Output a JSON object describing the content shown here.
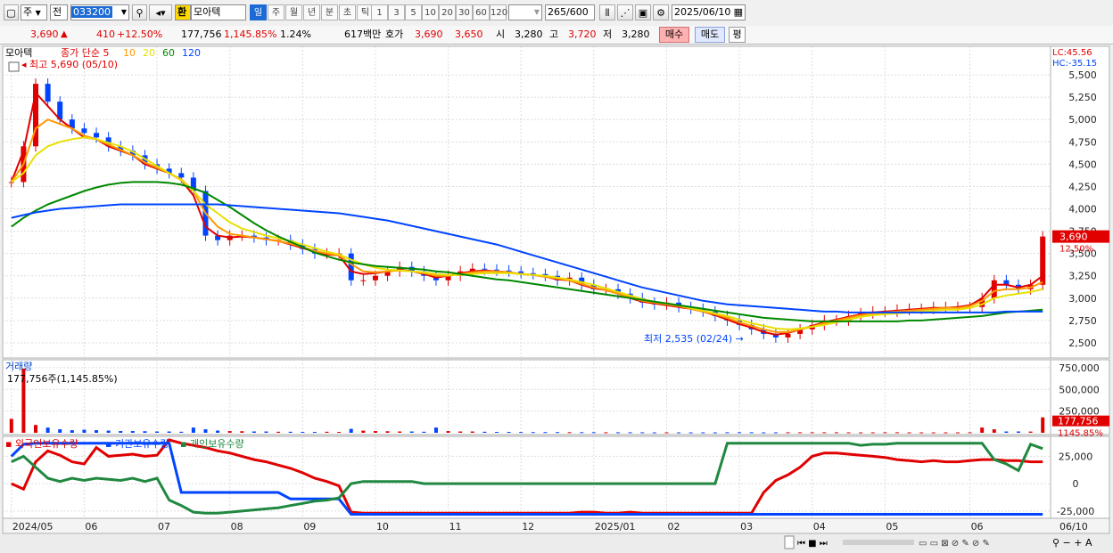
{
  "toolbar": {
    "market_label": "주",
    "prev_label": "전",
    "stock_code": "033200",
    "hwan_label": "환",
    "stock_name": "모아텍",
    "periods": [
      "일",
      "주",
      "월",
      "년",
      "분",
      "초",
      "틱"
    ],
    "active_period": "일",
    "counts": [
      "1",
      "3",
      "5",
      "10",
      "20",
      "30",
      "60",
      "120"
    ],
    "view_count": "265",
    "max_count": "/600",
    "date": "2025/06/10"
  },
  "quote": {
    "price": "3,690",
    "change_arrow": "▲",
    "change": "410",
    "change_pct": "+12.50%",
    "volume": "177,756",
    "volume_ratio": "1,145.85%",
    "turnover": "1.24%",
    "amount": "617백만",
    "bid_label": "호가",
    "bid1": "3,690",
    "bid2": "3,650",
    "open_label": "시",
    "open": "3,280",
    "high_label": "고",
    "high": "3,720",
    "low_label": "저",
    "low": "3,280",
    "buy_label": "매수",
    "sell_label": "매도",
    "avg_label": "평"
  },
  "chart_data": [
    {
      "type": "candlestick",
      "title": "모아텍",
      "legend": [
        {
          "name": "종가 단순 5",
          "color": "#e00000"
        },
        {
          "name": "10",
          "color": "#ff9900"
        },
        {
          "name": "20",
          "color": "#e8e000"
        },
        {
          "name": "60",
          "color": "#008800"
        },
        {
          "name": "120",
          "color": "#0044ff"
        }
      ],
      "x_ticks": [
        "2024/05",
        "06",
        "07",
        "08",
        "09",
        "10",
        "11",
        "12",
        "2025/01",
        "02",
        "03",
        "04",
        "05",
        "06"
      ],
      "last_x_label": "06/10",
      "y_ticks": [
        2500,
        2750,
        3000,
        3250,
        3500,
        3750,
        4000,
        4250,
        4500,
        4750,
        5000,
        5250,
        5500
      ],
      "ylim": [
        2350,
        5800
      ],
      "lc_label": "LC:45.56",
      "hc_label": "HC:-35.15",
      "max_annotation": "최고 5,690 (05/10)",
      "min_annotation": "최저 2,535 (02/24)",
      "last_price_label": "3,690",
      "last_pct_label": "12.50%",
      "close": [
        4300,
        4700,
        5400,
        5200,
        5000,
        4900,
        4850,
        4800,
        4700,
        4650,
        4600,
        4500,
        4450,
        4400,
        4350,
        4200,
        3700,
        3650,
        3700,
        3700,
        3680,
        3650,
        3650,
        3600,
        3550,
        3500,
        3500,
        3500,
        3200,
        3200,
        3250,
        3300,
        3350,
        3300,
        3250,
        3200,
        3250,
        3300,
        3330,
        3320,
        3310,
        3300,
        3280,
        3270,
        3250,
        3200,
        3230,
        3150,
        3100,
        3100,
        3050,
        3000,
        2950,
        2930,
        2950,
        2900,
        2880,
        2850,
        2800,
        2750,
        2700,
        2650,
        2600,
        2560,
        2600,
        2650,
        2700,
        2750,
        2750,
        2800,
        2830,
        2850,
        2850,
        2870,
        2880,
        2880,
        2900,
        2900,
        2900,
        2900,
        3000,
        3200,
        3150,
        3100,
        3150,
        3690
      ],
      "moving_averages": {
        "5": [
          4300,
          4650,
          5300,
          5150,
          5000,
          4900,
          4800,
          4780,
          4700,
          4650,
          4600,
          4500,
          4450,
          4400,
          4320,
          4150,
          3800,
          3700,
          3680,
          3690,
          3680,
          3660,
          3640,
          3600,
          3560,
          3520,
          3490,
          3480,
          3300,
          3270,
          3280,
          3300,
          3320,
          3300,
          3270,
          3230,
          3250,
          3280,
          3300,
          3310,
          3300,
          3290,
          3270,
          3260,
          3240,
          3210,
          3200,
          3150,
          3110,
          3090,
          3050,
          3000,
          2960,
          2940,
          2920,
          2900,
          2880,
          2850,
          2810,
          2760,
          2710,
          2670,
          2620,
          2590,
          2610,
          2650,
          2690,
          2730,
          2760,
          2790,
          2820,
          2840,
          2850,
          2860,
          2870,
          2880,
          2890,
          2890,
          2900,
          2920,
          3000,
          3150,
          3150,
          3120,
          3150,
          3250
        ],
        "10": [
          4300,
          4500,
          4900,
          5000,
          4950,
          4900,
          4820,
          4780,
          4720,
          4660,
          4600,
          4520,
          4460,
          4400,
          4330,
          4200,
          3950,
          3800,
          3720,
          3700,
          3680,
          3660,
          3640,
          3610,
          3570,
          3530,
          3500,
          3480,
          3380,
          3300,
          3290,
          3300,
          3310,
          3300,
          3280,
          3250,
          3250,
          3270,
          3290,
          3300,
          3300,
          3290,
          3270,
          3260,
          3240,
          3220,
          3200,
          3160,
          3120,
          3090,
          3050,
          3010,
          2970,
          2950,
          2930,
          2910,
          2880,
          2850,
          2820,
          2780,
          2730,
          2690,
          2650,
          2620,
          2620,
          2650,
          2680,
          2720,
          2750,
          2780,
          2810,
          2830,
          2840,
          2850,
          2860,
          2870,
          2880,
          2890,
          2890,
          2910,
          2970,
          3080,
          3100,
          3100,
          3120,
          3180
        ],
        "20": [
          4300,
          4400,
          4600,
          4700,
          4750,
          4780,
          4800,
          4780,
          4740,
          4700,
          4640,
          4560,
          4480,
          4400,
          4320,
          4200,
          4050,
          3950,
          3850,
          3780,
          3740,
          3700,
          3670,
          3640,
          3600,
          3560,
          3520,
          3490,
          3430,
          3380,
          3340,
          3320,
          3310,
          3300,
          3290,
          3270,
          3260,
          3260,
          3270,
          3280,
          3280,
          3280,
          3270,
          3260,
          3250,
          3230,
          3210,
          3180,
          3150,
          3110,
          3070,
          3030,
          2990,
          2960,
          2940,
          2920,
          2890,
          2860,
          2830,
          2800,
          2760,
          2720,
          2690,
          2660,
          2650,
          2660,
          2680,
          2700,
          2730,
          2760,
          2790,
          2810,
          2820,
          2830,
          2840,
          2850,
          2860,
          2870,
          2870,
          2890,
          2930,
          3000,
          3030,
          3050,
          3070,
          3100
        ],
        "60": [
          3800,
          3900,
          3980,
          4050,
          4100,
          4150,
          4200,
          4240,
          4270,
          4290,
          4300,
          4300,
          4300,
          4290,
          4270,
          4230,
          4180,
          4100,
          4020,
          3930,
          3840,
          3760,
          3690,
          3630,
          3570,
          3510,
          3470,
          3430,
          3400,
          3380,
          3360,
          3350,
          3340,
          3330,
          3320,
          3300,
          3290,
          3270,
          3250,
          3230,
          3210,
          3200,
          3180,
          3160,
          3140,
          3120,
          3100,
          3080,
          3060,
          3040,
          3020,
          3000,
          2980,
          2960,
          2940,
          2920,
          2900,
          2880,
          2860,
          2840,
          2820,
          2800,
          2780,
          2770,
          2760,
          2750,
          2740,
          2740,
          2740,
          2740,
          2740,
          2740,
          2740,
          2740,
          2750,
          2750,
          2760,
          2770,
          2780,
          2790,
          2800,
          2820,
          2840,
          2850,
          2860,
          2870
        ],
        "120": [
          3900,
          3930,
          3960,
          3980,
          4000,
          4010,
          4020,
          4030,
          4040,
          4050,
          4050,
          4050,
          4050,
          4050,
          4050,
          4050,
          4050,
          4050,
          4040,
          4030,
          4020,
          4010,
          4000,
          3990,
          3980,
          3970,
          3960,
          3950,
          3930,
          3910,
          3890,
          3870,
          3840,
          3810,
          3780,
          3750,
          3720,
          3690,
          3660,
          3630,
          3600,
          3560,
          3520,
          3480,
          3440,
          3400,
          3360,
          3320,
          3280,
          3240,
          3200,
          3160,
          3120,
          3090,
          3060,
          3030,
          3000,
          2970,
          2950,
          2930,
          2920,
          2910,
          2900,
          2890,
          2880,
          2870,
          2860,
          2850,
          2850,
          2840,
          2840,
          2840,
          2840,
          2840,
          2840,
          2840,
          2840,
          2840,
          2840,
          2840,
          2840,
          2840,
          2850,
          2850,
          2850,
          2850
        ]
      }
    },
    {
      "type": "bar",
      "title": "거래량",
      "volume_label": "177,756주(1,145.85%)",
      "y_ticks": [
        250000,
        500000,
        750000
      ],
      "ylim": [
        0,
        800000
      ],
      "last_value_label": "177,756",
      "last_ratio_label": "1145.85%",
      "values": [
        160000,
        740000,
        90000,
        60000,
        40000,
        30000,
        35000,
        30000,
        25000,
        20000,
        20000,
        18000,
        15000,
        15000,
        12000,
        60000,
        40000,
        25000,
        20000,
        18000,
        15000,
        15000,
        12000,
        12000,
        10000,
        10000,
        12000,
        10000,
        45000,
        25000,
        20000,
        18000,
        15000,
        15000,
        12000,
        60000,
        20000,
        15000,
        15000,
        12000,
        10000,
        10000,
        9000,
        8000,
        8000,
        8000,
        7000,
        7000,
        7000,
        6000,
        6000,
        6000,
        6000,
        5000,
        5000,
        5000,
        5000,
        5000,
        5000,
        6000,
        7000,
        6000,
        5000,
        5000,
        6000,
        6000,
        6000,
        6000,
        6000,
        5000,
        5000,
        5000,
        6000,
        6000,
        5000,
        5000,
        5000,
        5000,
        5000,
        6000,
        60000,
        40000,
        15000,
        15000,
        14000,
        177756
      ]
    },
    {
      "type": "line",
      "title": "외국인보유수량 · 기관보유수량 · 개인보유수량",
      "series_names": [
        "외국인보유수량",
        "기관보유수량",
        "개인보유수량"
      ],
      "colors": [
        "#e00000",
        "#0044ff",
        "#208840"
      ],
      "y_ticks": [
        -25000,
        0,
        25000
      ],
      "ylim": [
        -30000,
        40000
      ],
      "series": [
        {
          "name": "외국인보유수량",
          "values": [
            0,
            -5000,
            20000,
            30000,
            26000,
            20000,
            18000,
            33000,
            25000,
            26000,
            27000,
            25000,
            26000,
            40000,
            37000,
            35000,
            33000,
            30000,
            28000,
            25000,
            22000,
            20000,
            17000,
            14000,
            10000,
            5000,
            2000,
            -2000,
            -26000,
            -27000,
            -27000,
            -27000,
            -27000,
            -27000,
            -27000,
            -27000,
            -27000,
            -27000,
            -27000,
            -27000,
            -27000,
            -27000,
            -27000,
            -27000,
            -27000,
            -27000,
            -27000,
            -26000,
            -26000,
            -27000,
            -27000,
            -26000,
            -27000,
            -27000,
            -27000,
            -27000,
            -27000,
            -27000,
            -27000,
            -27000,
            -27000,
            -27000,
            -8000,
            3000,
            8000,
            15000,
            25000,
            28000,
            28000,
            27000,
            26000,
            25000,
            24000,
            22000,
            21000,
            20000,
            21000,
            20000,
            20000,
            21000,
            22000,
            22000,
            21000,
            21000,
            20000,
            20000
          ]
        },
        {
          "name": "기관보유수량",
          "values": [
            25000,
            36000,
            37000,
            37000,
            37000,
            37000,
            37000,
            37000,
            37000,
            37000,
            37000,
            37000,
            37000,
            37000,
            -8000,
            -8000,
            -8000,
            -8000,
            -8000,
            -8000,
            -8000,
            -8000,
            -8000,
            -14000,
            -14000,
            -14000,
            -14000,
            -14000,
            -28000,
            -28000,
            -28000,
            -28000,
            -28000,
            -28000,
            -28000,
            -28000,
            -28000,
            -28000,
            -28000,
            -28000,
            -28000,
            -28000,
            -28000,
            -28000,
            -28000,
            -28000,
            -28000,
            -28000,
            -28000,
            -28000,
            -28000,
            -28000,
            -28000,
            -28000,
            -28000,
            -28000,
            -28000,
            -28000,
            -28000,
            -28000,
            -28000,
            -28000,
            -28000,
            -28000,
            -28000,
            -28000,
            -28000,
            -28000,
            -28000,
            -28000,
            -28000,
            -28000,
            -28000,
            -28000,
            -28000,
            -28000,
            -28000,
            -28000,
            -28000,
            -28000,
            -28000,
            -28000,
            -28000,
            -28000,
            -28000,
            -28000
          ]
        },
        {
          "name": "개인보유수량",
          "values": [
            20000,
            25000,
            15000,
            5000,
            2000,
            5000,
            3000,
            5000,
            4000,
            3000,
            5000,
            2000,
            5000,
            -15000,
            -20000,
            -26000,
            -27000,
            -27000,
            -26000,
            -25000,
            -24000,
            -23000,
            -22000,
            -20000,
            -18000,
            -16000,
            -15000,
            -13000,
            0,
            2000,
            2000,
            2000,
            2000,
            2000,
            0,
            0,
            0,
            0,
            0,
            0,
            0,
            0,
            0,
            0,
            0,
            0,
            0,
            0,
            0,
            0,
            0,
            0,
            0,
            0,
            0,
            0,
            0,
            0,
            0,
            37000,
            37000,
            37000,
            37000,
            37000,
            37000,
            37000,
            37000,
            37000,
            37000,
            37000,
            35000,
            36000,
            36000,
            37000,
            37000,
            37000,
            37000,
            37000,
            37000,
            37000,
            37000,
            22000,
            18000,
            12000,
            36000,
            32000
          ]
        }
      ]
    }
  ]
}
